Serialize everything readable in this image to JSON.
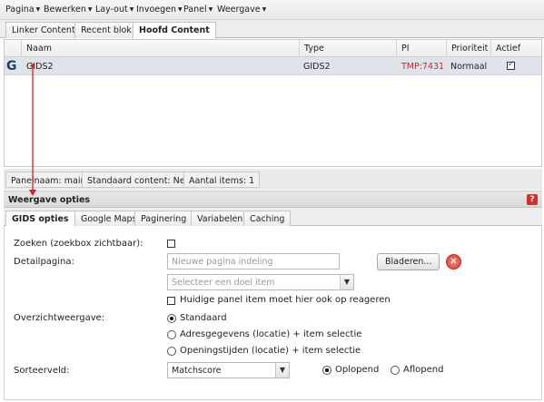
{
  "menubar": {
    "items": [
      "Pagina",
      "Bewerken",
      "Lay-out",
      "Invoegen",
      "Panel",
      "Weergave"
    ]
  },
  "top_tabs": [
    {
      "label": "Linker Content",
      "active": false
    },
    {
      "label": "Recent blok",
      "active": false
    },
    {
      "label": "Hoofd Content",
      "active": true
    }
  ],
  "grid": {
    "columns": [
      "Naam",
      "Type",
      "PI",
      "Prioriteit",
      "Actief"
    ],
    "rows": [
      {
        "naam": "GIDS2",
        "type": "GIDS2",
        "pi": "TMP:7431",
        "prioriteit": "Normaal",
        "actief": true
      }
    ]
  },
  "status": {
    "panelnaam": "Panelnaam: main",
    "standaard": "Standaard content: Nee",
    "aantal": "Aantal items: 1"
  },
  "section": {
    "title": "Weergave opties",
    "help": "?"
  },
  "sub_tabs": [
    {
      "label": "GIDS opties",
      "active": true
    },
    {
      "label": "Google Maps",
      "active": false
    },
    {
      "label": "Paginering",
      "active": false
    },
    {
      "label": "Variabelen",
      "active": false
    },
    {
      "label": "Caching",
      "active": false
    }
  ],
  "form": {
    "zoeken_label": "Zoeken (zoekbox zichtbaar):",
    "zoeken_checked": false,
    "detail_label": "Detailpagina:",
    "detail_placeholder": "Nieuwe pagina indeling",
    "bladeren": "Bladeren...",
    "doel_placeholder": "Selecteer een doel item",
    "reageren_label": "Huidige panel item moet hier ook op reageren",
    "reageren_checked": false,
    "overzicht_label": "Overzichtweergave:",
    "overzicht_options": [
      {
        "label": "Standaard",
        "selected": true
      },
      {
        "label": "Adresgegevens (locatie) + item selectie",
        "selected": false
      },
      {
        "label": "Openingstijden (locatie) + item selectie",
        "selected": false
      }
    ],
    "sorteer_label": "Sorteerveld:",
    "sorteer_value": "Matchscore",
    "order_options": [
      {
        "label": "Oplopend",
        "selected": true
      },
      {
        "label": "Aflopend",
        "selected": false
      }
    ]
  },
  "colors": {
    "pi_red": "#e02020",
    "row_selected": "#dfe4ea",
    "arrow": "#e02020",
    "help_red": "#d4312c"
  },
  "icons": [
    "caret-down-icon",
    "gids-icon",
    "help-icon",
    "clear-icon",
    "dropdown-arrow-icon"
  ]
}
